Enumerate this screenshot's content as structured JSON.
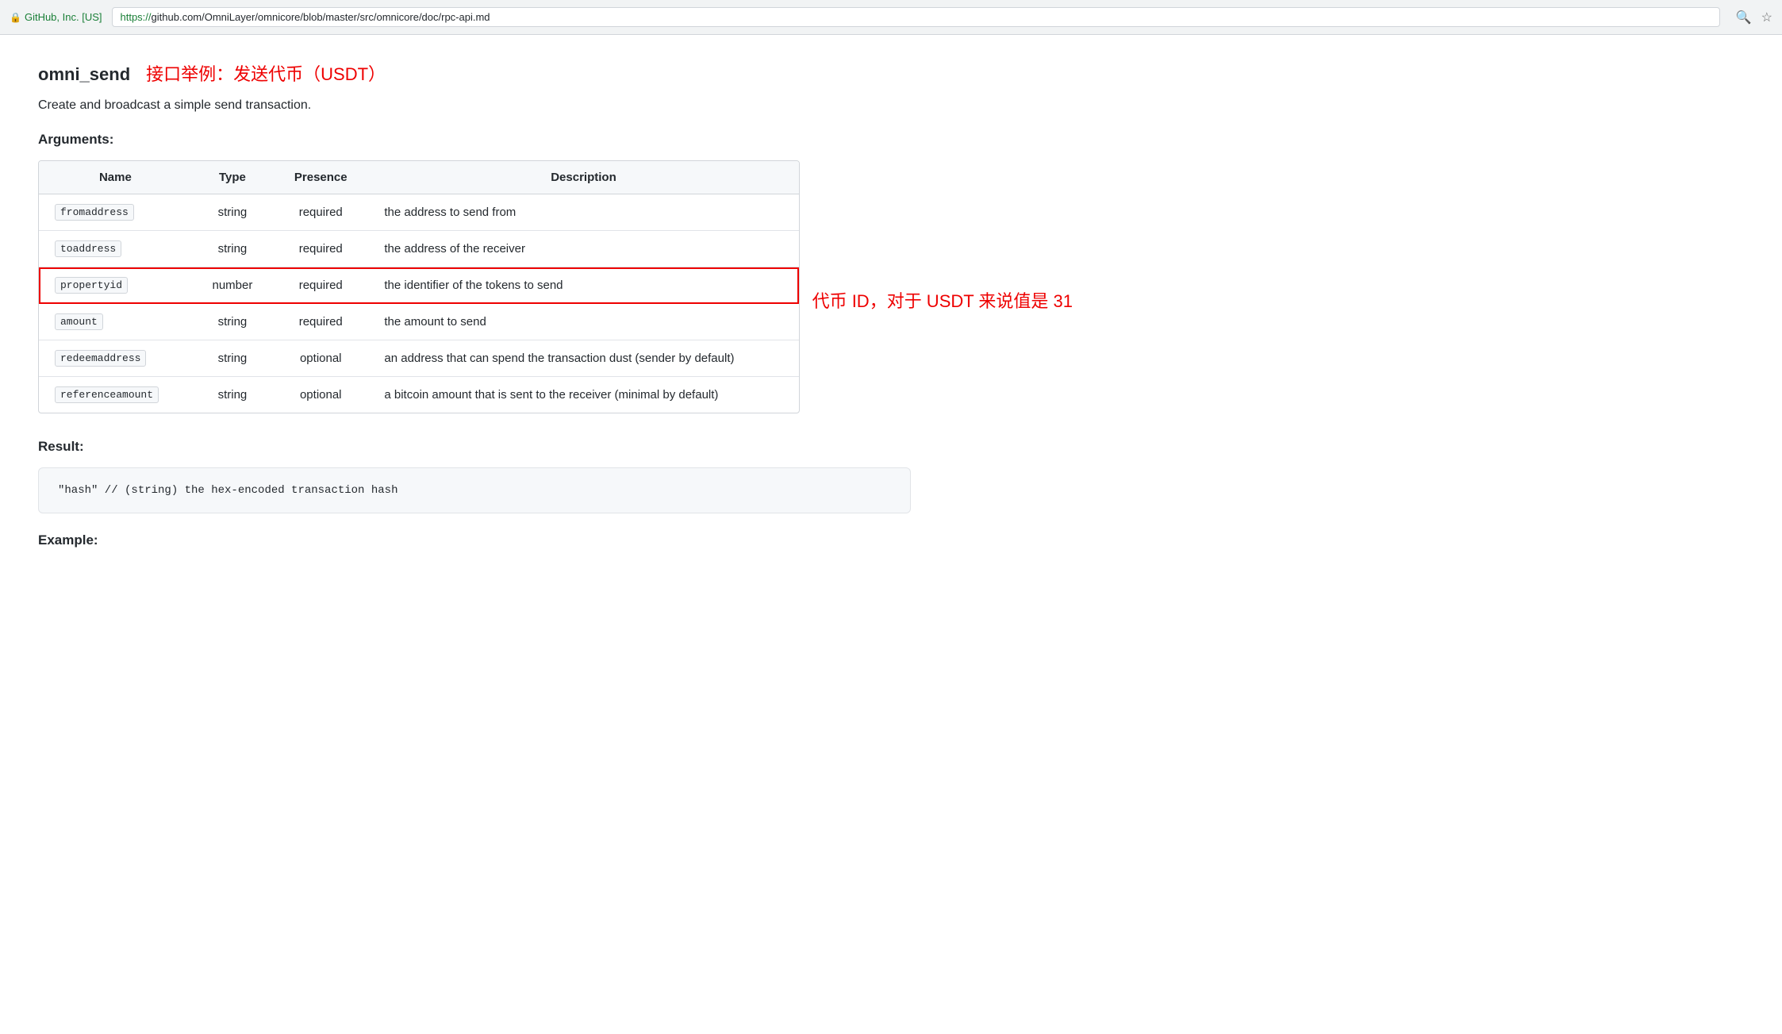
{
  "browser": {
    "security_label": "GitHub, Inc. [US]",
    "url_prefix": "https://",
    "url_domain": "github.com",
    "url_path": "/OmniLayer/omnicore/blob/master/src/omnicore/doc/rpc-api.md"
  },
  "page": {
    "api_name": "omni_send",
    "api_subtitle": "接口举例：发送代币（USDT）",
    "description": "Create and broadcast a simple send transaction.",
    "arguments_label": "Arguments:",
    "result_label": "Result:",
    "example_label": "Example:",
    "table": {
      "headers": [
        "Name",
        "Type",
        "Presence",
        "Description"
      ],
      "rows": [
        {
          "name": "fromaddress",
          "type": "string",
          "presence": "required",
          "description": "the address to send from",
          "highlighted": false
        },
        {
          "name": "toaddress",
          "type": "string",
          "presence": "required",
          "description": "the address of the receiver",
          "highlighted": false
        },
        {
          "name": "propertyid",
          "type": "number",
          "presence": "required",
          "description": "the identifier of the tokens to send",
          "highlighted": true,
          "annotation": "代币 ID，对于 USDT 来说值是 31"
        },
        {
          "name": "amount",
          "type": "string",
          "presence": "required",
          "description": "the amount to send",
          "highlighted": false
        },
        {
          "name": "redeemaddress",
          "type": "string",
          "presence": "optional",
          "description": "an address that can spend the transaction dust (sender by default)",
          "highlighted": false
        },
        {
          "name": "referenceamount",
          "type": "string",
          "presence": "optional",
          "description": "a bitcoin amount that is sent to the receiver (minimal by default)",
          "highlighted": false
        }
      ]
    },
    "result_code": "\"hash\"  // (string) the hex-encoded transaction hash",
    "example_placeholder": ""
  }
}
